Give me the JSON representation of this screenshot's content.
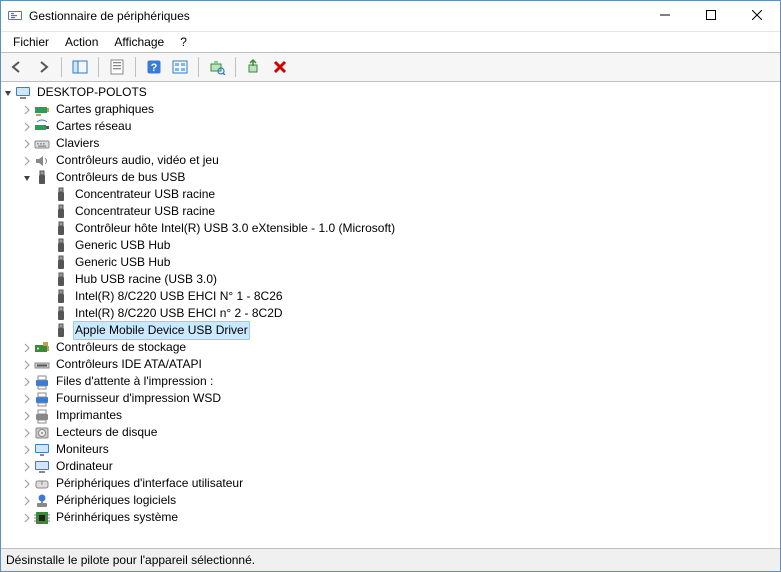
{
  "window": {
    "title": "Gestionnaire de périphériques"
  },
  "menubar": {
    "items": [
      {
        "label": "Fichier"
      },
      {
        "label": "Action"
      },
      {
        "label": "Affichage"
      },
      {
        "label": "?"
      }
    ]
  },
  "toolbar": {
    "buttons": [
      {
        "name": "back-icon"
      },
      {
        "name": "forward-icon"
      },
      {
        "sep": true
      },
      {
        "name": "show-hide-console-tree-icon"
      },
      {
        "sep": true
      },
      {
        "name": "properties-icon"
      },
      {
        "sep": true
      },
      {
        "name": "help-icon"
      },
      {
        "name": "devices-by-type-icon"
      },
      {
        "sep": true
      },
      {
        "name": "scan-hardware-icon"
      },
      {
        "sep": true
      },
      {
        "name": "update-driver-icon"
      },
      {
        "name": "uninstall-device-icon"
      }
    ]
  },
  "tree": {
    "root": {
      "label": "DESKTOP-POLOTS",
      "icon": "computer-icon",
      "expanded": true
    },
    "categories": [
      {
        "label": "Cartes graphiques",
        "icon": "display-adapter-icon",
        "expanded": false,
        "children": []
      },
      {
        "label": "Cartes réseau",
        "icon": "network-adapter-icon",
        "expanded": false,
        "children": []
      },
      {
        "label": "Claviers",
        "icon": "keyboard-icon",
        "expanded": false,
        "children": []
      },
      {
        "label": "Contrôleurs audio, vidéo et jeu",
        "icon": "sound-icon",
        "expanded": false,
        "children": []
      },
      {
        "label": "Contrôleurs de bus USB",
        "icon": "usb-icon",
        "expanded": true,
        "children": [
          {
            "label": "Concentrateur USB racine",
            "icon": "usb-icon"
          },
          {
            "label": "Concentrateur USB racine",
            "icon": "usb-icon"
          },
          {
            "label": "Contrôleur hôte Intel(R) USB 3.0 eXtensible - 1.0 (Microsoft)",
            "icon": "usb-icon"
          },
          {
            "label": "Generic USB Hub",
            "icon": "usb-icon"
          },
          {
            "label": "Generic USB Hub",
            "icon": "usb-icon"
          },
          {
            "label": "Hub USB racine (USB 3.0)",
            "icon": "usb-icon"
          },
          {
            "label": "Intel(R) 8/C220 USB EHCI N° 1 - 8C26",
            "icon": "usb-icon"
          },
          {
            "label": "Intel(R) 8/C220 USB EHCI n° 2 - 8C2D",
            "icon": "usb-icon"
          },
          {
            "label": "Apple Mobile Device USB Driver",
            "icon": "usb-icon",
            "selected": true
          }
        ]
      },
      {
        "label": "Contrôleurs de stockage",
        "icon": "storage-controller-icon",
        "expanded": false,
        "children": []
      },
      {
        "label": "Contrôleurs IDE ATA/ATAPI",
        "icon": "ide-controller-icon",
        "expanded": false,
        "children": []
      },
      {
        "label": "Files d'attente à l'impression :",
        "icon": "print-queue-icon",
        "expanded": false,
        "children": []
      },
      {
        "label": "Fournisseur d'impression WSD",
        "icon": "print-queue-icon",
        "expanded": false,
        "children": []
      },
      {
        "label": "Imprimantes",
        "icon": "printer-icon",
        "expanded": false,
        "children": []
      },
      {
        "label": "Lecteurs de disque",
        "icon": "disk-drive-icon",
        "expanded": false,
        "children": []
      },
      {
        "label": "Moniteurs",
        "icon": "monitor-icon",
        "expanded": false,
        "children": []
      },
      {
        "label": "Ordinateur",
        "icon": "computer-icon",
        "expanded": false,
        "children": []
      },
      {
        "label": "Périphériques d'interface utilisateur",
        "icon": "hid-icon",
        "expanded": false,
        "children": []
      },
      {
        "label": "Périphériques logiciels",
        "icon": "software-device-icon",
        "expanded": false,
        "children": []
      },
      {
        "label": "Périnhériques système",
        "icon": "system-device-icon",
        "expanded": false,
        "children": []
      }
    ]
  },
  "statusbar": {
    "text": "Désinstalle le pilote pour l'appareil sélectionné."
  },
  "colors": {
    "selection_bg": "#cce8ff",
    "selection_border": "#99c9ff",
    "window_border": "#5a8fc8"
  }
}
